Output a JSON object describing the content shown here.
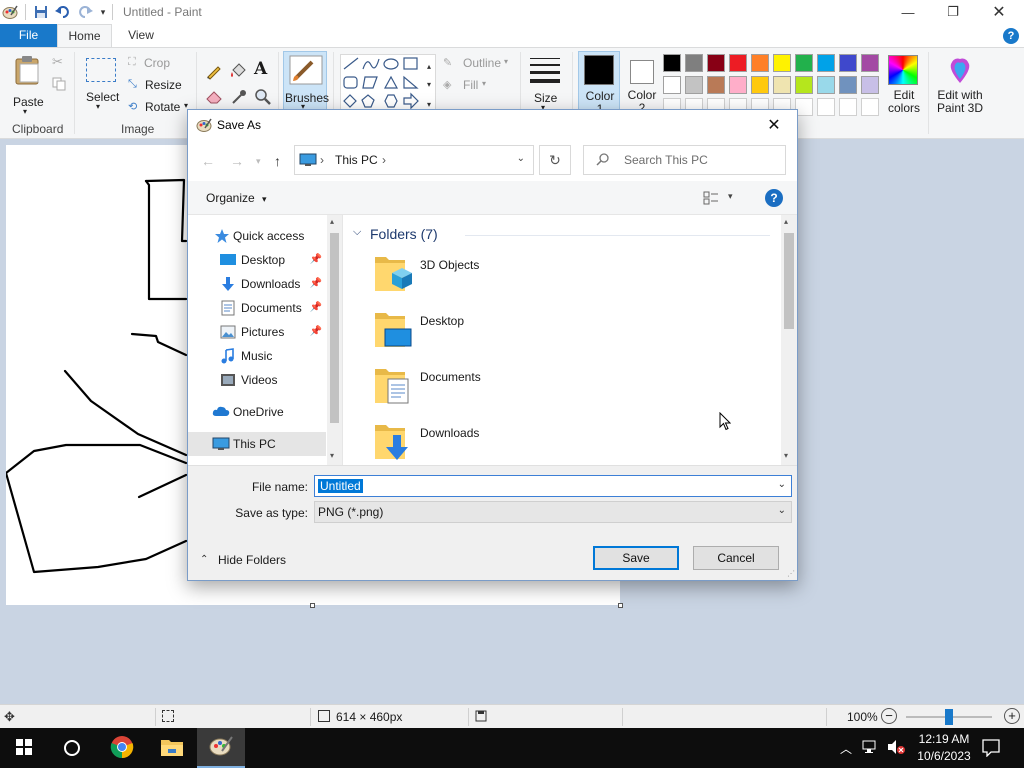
{
  "app": {
    "title": "Untitled - Paint"
  },
  "ribbon": {
    "tabs": [
      "File",
      "Home",
      "View"
    ],
    "clipboard": {
      "paste_label": "Paste",
      "group_label": "Clipboard"
    },
    "image": {
      "select_label": "Select",
      "crop_label": "Crop",
      "resize_label": "Resize",
      "rotate_label": "Rotate",
      "group_label": "Image"
    },
    "brushes_label": "Brushes",
    "shapes": {
      "outline_label": "Outline",
      "fill_label": "Fill"
    },
    "size_label": "Size",
    "color1_label": "Color 1",
    "color2_label": "Color 2",
    "edit_colors_label": "Edit colors",
    "paint3d_label": "Edit with Paint 3D",
    "palette_row1": [
      "#000000",
      "#7f7f7f",
      "#880015",
      "#ed1c24",
      "#ff7f27",
      "#fff200",
      "#22b14c",
      "#00a2e8",
      "#3f48cc",
      "#a349a4"
    ],
    "palette_row2": [
      "#ffffff",
      "#c3c3c3",
      "#b97a57",
      "#ffaec9",
      "#ffc90e",
      "#efe4b0",
      "#b5e61d",
      "#99d9ea",
      "#7092be",
      "#c8bfe7"
    ]
  },
  "statusbar": {
    "canvas_size": "614 × 460px",
    "zoom": "100%",
    "zoom_level_percent": 100
  },
  "taskbar": {
    "time": "12:19 AM",
    "date": "10/6/2023"
  },
  "dialog": {
    "title": "Save As",
    "address": "This PC",
    "search_placeholder": "Search This PC",
    "organize_label": "Organize",
    "nav_items": [
      {
        "label": "Quick access",
        "icon": "star-icon"
      },
      {
        "label": "Desktop",
        "icon": "desktop-icon",
        "pinned": true
      },
      {
        "label": "Downloads",
        "icon": "download-icon",
        "pinned": true
      },
      {
        "label": "Documents",
        "icon": "document-icon",
        "pinned": true
      },
      {
        "label": "Pictures",
        "icon": "picture-icon",
        "pinned": true
      },
      {
        "label": "Music",
        "icon": "music-icon"
      },
      {
        "label": "Videos",
        "icon": "video-icon"
      },
      {
        "label": "OneDrive",
        "icon": "cloud-icon"
      },
      {
        "label": "This PC",
        "icon": "computer-icon",
        "selected": true
      }
    ],
    "folders_header": "Folders (7)",
    "folders": [
      "3D Objects",
      "Desktop",
      "Documents",
      "Downloads"
    ],
    "file_name_label": "File name:",
    "file_name_value": "Untitled",
    "save_type_label": "Save as type:",
    "save_type_value": "PNG (*.png)",
    "hide_folders_label": "Hide Folders",
    "save_button": "Save",
    "cancel_button": "Cancel"
  }
}
